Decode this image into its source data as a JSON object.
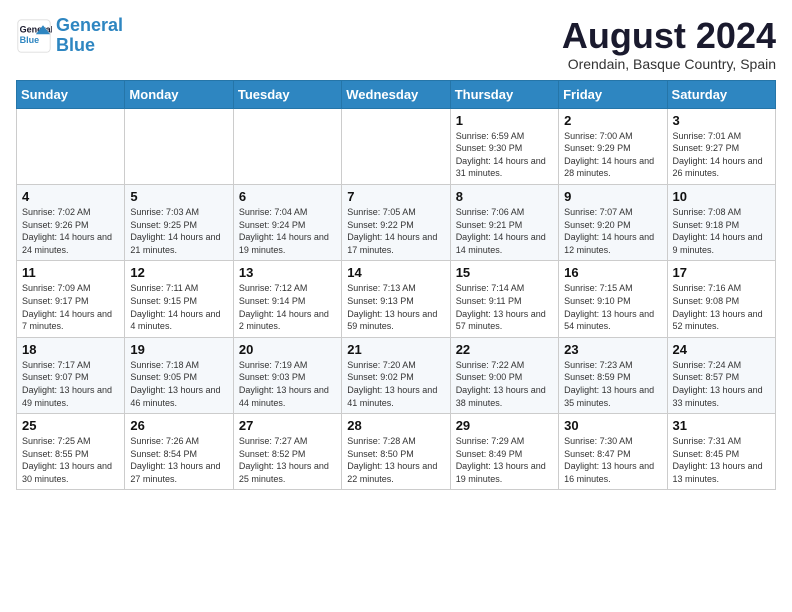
{
  "logo": {
    "line1": "General",
    "line2": "Blue"
  },
  "title": "August 2024",
  "location": "Orendain, Basque Country, Spain",
  "weekdays": [
    "Sunday",
    "Monday",
    "Tuesday",
    "Wednesday",
    "Thursday",
    "Friday",
    "Saturday"
  ],
  "weeks": [
    [
      {
        "day": "",
        "info": ""
      },
      {
        "day": "",
        "info": ""
      },
      {
        "day": "",
        "info": ""
      },
      {
        "day": "",
        "info": ""
      },
      {
        "day": "1",
        "info": "Sunrise: 6:59 AM\nSunset: 9:30 PM\nDaylight: 14 hours and 31 minutes."
      },
      {
        "day": "2",
        "info": "Sunrise: 7:00 AM\nSunset: 9:29 PM\nDaylight: 14 hours and 28 minutes."
      },
      {
        "day": "3",
        "info": "Sunrise: 7:01 AM\nSunset: 9:27 PM\nDaylight: 14 hours and 26 minutes."
      }
    ],
    [
      {
        "day": "4",
        "info": "Sunrise: 7:02 AM\nSunset: 9:26 PM\nDaylight: 14 hours and 24 minutes."
      },
      {
        "day": "5",
        "info": "Sunrise: 7:03 AM\nSunset: 9:25 PM\nDaylight: 14 hours and 21 minutes."
      },
      {
        "day": "6",
        "info": "Sunrise: 7:04 AM\nSunset: 9:24 PM\nDaylight: 14 hours and 19 minutes."
      },
      {
        "day": "7",
        "info": "Sunrise: 7:05 AM\nSunset: 9:22 PM\nDaylight: 14 hours and 17 minutes."
      },
      {
        "day": "8",
        "info": "Sunrise: 7:06 AM\nSunset: 9:21 PM\nDaylight: 14 hours and 14 minutes."
      },
      {
        "day": "9",
        "info": "Sunrise: 7:07 AM\nSunset: 9:20 PM\nDaylight: 14 hours and 12 minutes."
      },
      {
        "day": "10",
        "info": "Sunrise: 7:08 AM\nSunset: 9:18 PM\nDaylight: 14 hours and 9 minutes."
      }
    ],
    [
      {
        "day": "11",
        "info": "Sunrise: 7:09 AM\nSunset: 9:17 PM\nDaylight: 14 hours and 7 minutes."
      },
      {
        "day": "12",
        "info": "Sunrise: 7:11 AM\nSunset: 9:15 PM\nDaylight: 14 hours and 4 minutes."
      },
      {
        "day": "13",
        "info": "Sunrise: 7:12 AM\nSunset: 9:14 PM\nDaylight: 14 hours and 2 minutes."
      },
      {
        "day": "14",
        "info": "Sunrise: 7:13 AM\nSunset: 9:13 PM\nDaylight: 13 hours and 59 minutes."
      },
      {
        "day": "15",
        "info": "Sunrise: 7:14 AM\nSunset: 9:11 PM\nDaylight: 13 hours and 57 minutes."
      },
      {
        "day": "16",
        "info": "Sunrise: 7:15 AM\nSunset: 9:10 PM\nDaylight: 13 hours and 54 minutes."
      },
      {
        "day": "17",
        "info": "Sunrise: 7:16 AM\nSunset: 9:08 PM\nDaylight: 13 hours and 52 minutes."
      }
    ],
    [
      {
        "day": "18",
        "info": "Sunrise: 7:17 AM\nSunset: 9:07 PM\nDaylight: 13 hours and 49 minutes."
      },
      {
        "day": "19",
        "info": "Sunrise: 7:18 AM\nSunset: 9:05 PM\nDaylight: 13 hours and 46 minutes."
      },
      {
        "day": "20",
        "info": "Sunrise: 7:19 AM\nSunset: 9:03 PM\nDaylight: 13 hours and 44 minutes."
      },
      {
        "day": "21",
        "info": "Sunrise: 7:20 AM\nSunset: 9:02 PM\nDaylight: 13 hours and 41 minutes."
      },
      {
        "day": "22",
        "info": "Sunrise: 7:22 AM\nSunset: 9:00 PM\nDaylight: 13 hours and 38 minutes."
      },
      {
        "day": "23",
        "info": "Sunrise: 7:23 AM\nSunset: 8:59 PM\nDaylight: 13 hours and 35 minutes."
      },
      {
        "day": "24",
        "info": "Sunrise: 7:24 AM\nSunset: 8:57 PM\nDaylight: 13 hours and 33 minutes."
      }
    ],
    [
      {
        "day": "25",
        "info": "Sunrise: 7:25 AM\nSunset: 8:55 PM\nDaylight: 13 hours and 30 minutes."
      },
      {
        "day": "26",
        "info": "Sunrise: 7:26 AM\nSunset: 8:54 PM\nDaylight: 13 hours and 27 minutes."
      },
      {
        "day": "27",
        "info": "Sunrise: 7:27 AM\nSunset: 8:52 PM\nDaylight: 13 hours and 25 minutes."
      },
      {
        "day": "28",
        "info": "Sunrise: 7:28 AM\nSunset: 8:50 PM\nDaylight: 13 hours and 22 minutes."
      },
      {
        "day": "29",
        "info": "Sunrise: 7:29 AM\nSunset: 8:49 PM\nDaylight: 13 hours and 19 minutes."
      },
      {
        "day": "30",
        "info": "Sunrise: 7:30 AM\nSunset: 8:47 PM\nDaylight: 13 hours and 16 minutes."
      },
      {
        "day": "31",
        "info": "Sunrise: 7:31 AM\nSunset: 8:45 PM\nDaylight: 13 hours and 13 minutes."
      }
    ]
  ]
}
